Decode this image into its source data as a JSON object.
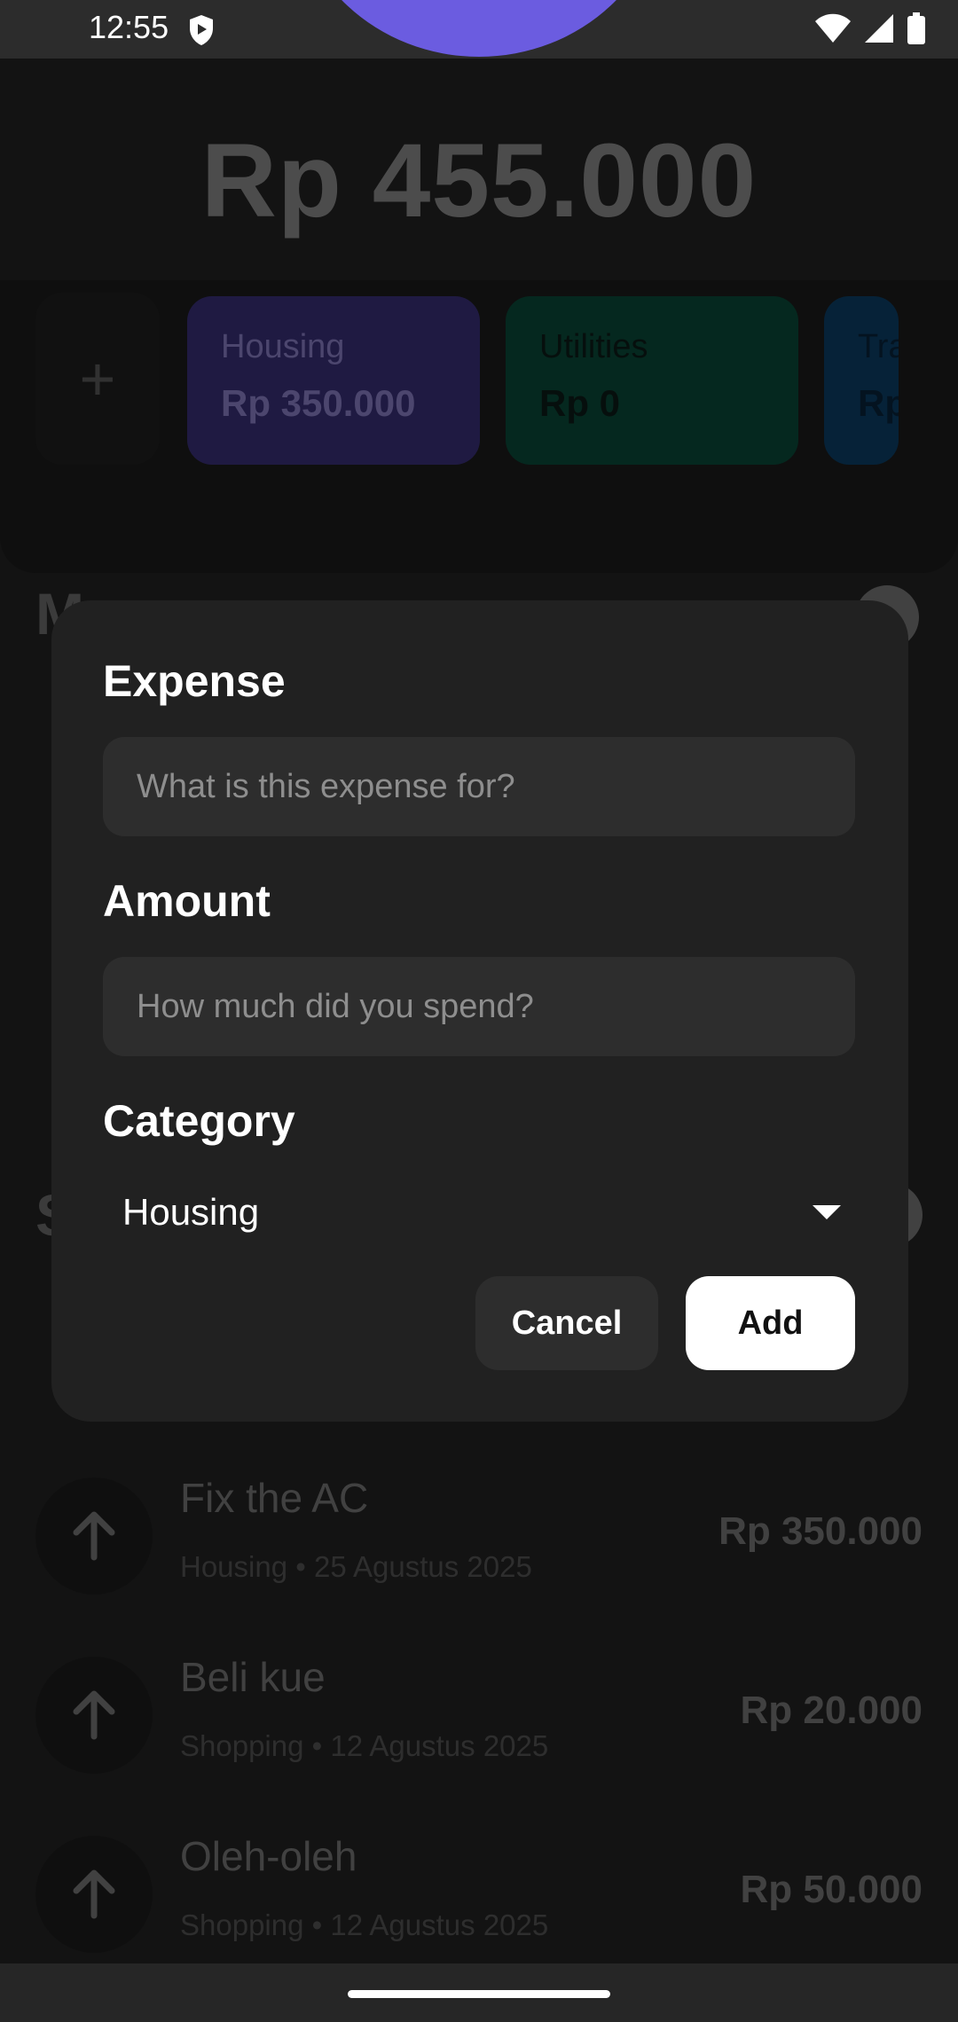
{
  "status_bar": {
    "time": "12:55",
    "icons": [
      "shield-icon",
      "wifi-icon",
      "signal-icon",
      "battery-icon"
    ]
  },
  "balance": "Rp 455.000",
  "categories": [
    {
      "name": "Housing",
      "amount": "Rp 350.000",
      "color": "#3a3178"
    },
    {
      "name": "Utilities",
      "amount": "Rp 0",
      "color": "#0a4a3a"
    },
    {
      "name": "Tra",
      "amount": "Rp",
      "color": "#0c3f66"
    }
  ],
  "transactions": [
    {
      "name": "Fix the AC",
      "category": "Housing",
      "date": "25 Agustus 2025",
      "amount": "Rp 350.000"
    },
    {
      "name": "Beli kue",
      "category": "Shopping",
      "date": "12 Agustus 2025",
      "amount": "Rp 20.000"
    },
    {
      "name": "Oleh-oleh",
      "category": "Shopping",
      "date": "12 Agustus 2025",
      "amount": "Rp 50.000"
    }
  ],
  "dialog": {
    "expense_label": "Expense",
    "expense_placeholder": "What is this expense for?",
    "amount_label": "Amount",
    "amount_placeholder": "How much did you spend?",
    "category_label": "Category",
    "category_value": "Housing",
    "cancel_label": "Cancel",
    "add_label": "Add"
  }
}
